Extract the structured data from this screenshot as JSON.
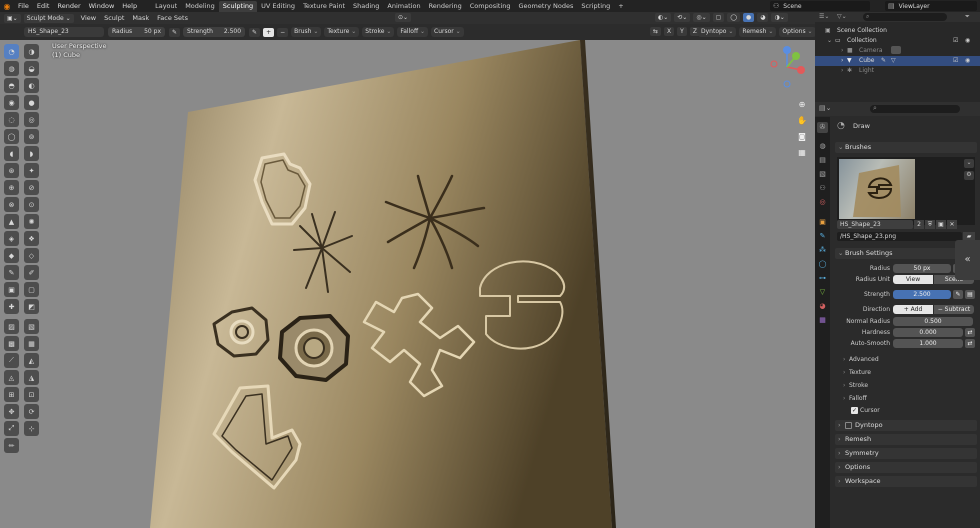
{
  "menu": {
    "items": [
      "File",
      "Edit",
      "Render",
      "Window",
      "Help"
    ],
    "workspaces": [
      "Layout",
      "Modeling",
      "Sculpting",
      "UV Editing",
      "Texture Paint",
      "Shading",
      "Animation",
      "Rendering",
      "Compositing",
      "Geometry Nodes",
      "Scripting"
    ],
    "active_workspace": "Sculpting",
    "scene_label": "Scene",
    "viewlayer_label": "ViewLayer"
  },
  "header": {
    "mode": "Sculpt Mode",
    "items": [
      "View",
      "Sculpt",
      "Mask",
      "Face Sets"
    ],
    "right_dropdowns": [
      "Dyntopo",
      "Remesh",
      "Options"
    ]
  },
  "tool_settings": {
    "brush_name": "HS_Shape_23",
    "radius_label": "Radius",
    "radius_value": "50 px",
    "strength_label": "Strength",
    "strength_value": "2.500",
    "dropdowns": [
      "Brush",
      "Texture",
      "Stroke",
      "Falloff",
      "Cursor"
    ]
  },
  "viewport": {
    "perspective": "User Perspective",
    "object": "(1) Cube",
    "background": "#8a8a8a",
    "surface_color": "#a99876"
  },
  "outliner": {
    "scene_collection": "Scene Collection",
    "collection": "Collection",
    "objects": [
      {
        "name": "Camera"
      },
      {
        "name": "Cube"
      },
      {
        "name": "Light"
      }
    ]
  },
  "properties": {
    "tool_name": "Draw",
    "brushes_section": "Brushes",
    "brush_name": "HS_Shape_23",
    "brush_users": "2",
    "texture_file": "HS_Shape_23.png",
    "brush_settings_section": "Brush Settings",
    "radius": {
      "label": "Radius",
      "value": "50 px"
    },
    "radius_unit": {
      "label": "Radius Unit",
      "options": [
        "View",
        "Scene"
      ],
      "selected": "View"
    },
    "strength": {
      "label": "Strength",
      "value": "2.500"
    },
    "direction": {
      "label": "Direction",
      "options": [
        "Add",
        "Subtract"
      ],
      "selected": "Add"
    },
    "normal_radius": {
      "label": "Normal Radius",
      "value": "0.500"
    },
    "hardness": {
      "label": "Hardness",
      "value": "0.000"
    },
    "auto_smooth": {
      "label": "Auto-Smooth",
      "value": "1.000"
    },
    "subpanels": [
      "Advanced",
      "Texture",
      "Stroke",
      "Falloff",
      "Cursor"
    ],
    "panels": [
      "Dyntopo",
      "Remesh",
      "Symmetry",
      "Options",
      "Workspace"
    ]
  },
  "colors": {
    "accent": "#4772b3",
    "panel_bg": "#2b2b2b",
    "header_bg": "#303030"
  }
}
